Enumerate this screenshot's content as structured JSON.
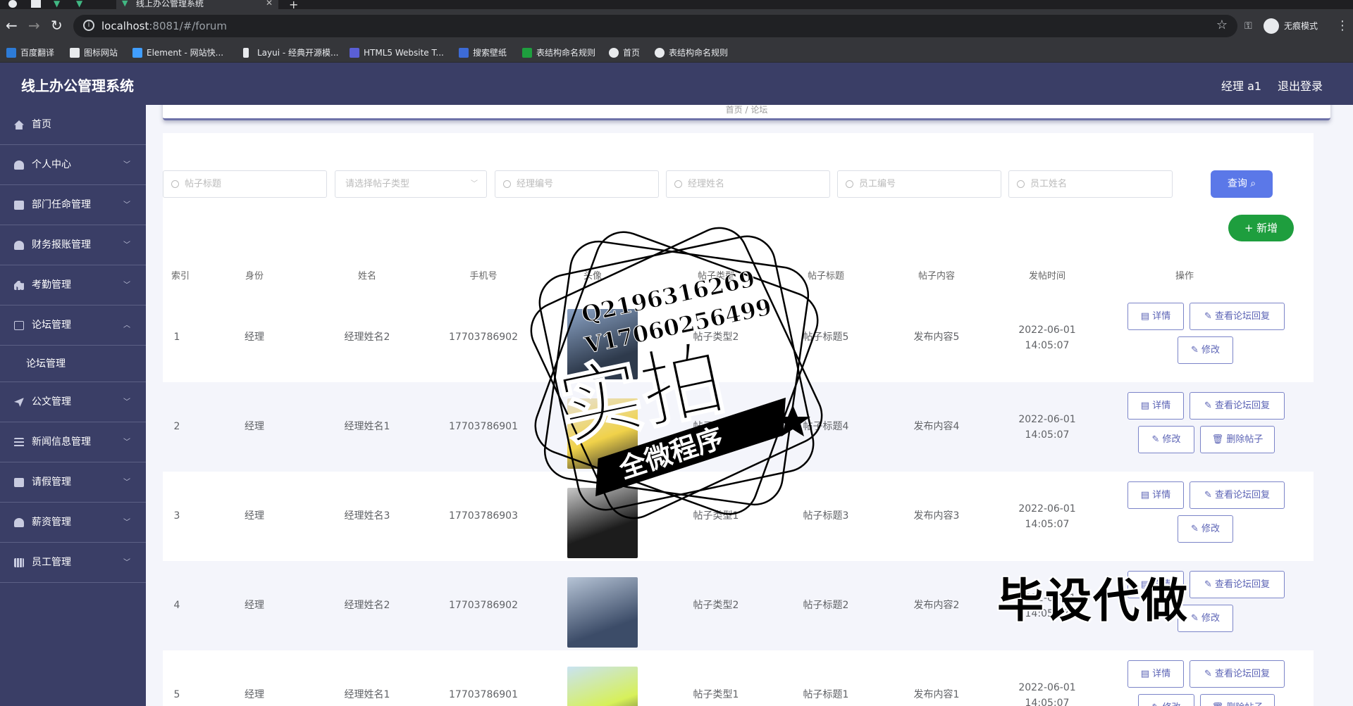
{
  "browser": {
    "tab_title": "线上办公管理系统",
    "url_host": "localhost",
    "url_rest": ":8081/#/forum",
    "incognito_label": "无痕模式",
    "bookmarks": [
      "百度翻译",
      "图标网站",
      "Element - 网站快...",
      "Layui - 经典开源模...",
      "HTML5 Website T...",
      "搜索壁纸",
      "表结构命名规则",
      "首页",
      "表结构命名规则"
    ]
  },
  "header": {
    "title": "线上办公管理系统",
    "user": "经理 a1",
    "logout": "退出登录"
  },
  "sidebar": {
    "items": [
      {
        "label": "首页"
      },
      {
        "label": "个人中心"
      },
      {
        "label": "部门任命管理"
      },
      {
        "label": "财务报账管理"
      },
      {
        "label": "考勤管理"
      },
      {
        "label": "论坛管理"
      },
      {
        "label": "论坛管理"
      },
      {
        "label": "公文管理"
      },
      {
        "label": "新闻信息管理"
      },
      {
        "label": "请假管理"
      },
      {
        "label": "薪资管理"
      },
      {
        "label": "员工管理"
      }
    ]
  },
  "breadcrumb": {
    "home": "首页",
    "current": "论坛"
  },
  "search": {
    "title_ph": "帖子标题",
    "type_ph": "请选择帖子类型",
    "mgr_no_ph": "经理编号",
    "mgr_name_ph": "经理姓名",
    "emp_no_ph": "员工编号",
    "emp_name_ph": "员工姓名",
    "query": "查询",
    "add": "+ 新增"
  },
  "table": {
    "headers": [
      "索引",
      "身份",
      "姓名",
      "手机号",
      "头像",
      "帖子类型",
      "帖子标题",
      "帖子内容",
      "发帖时间",
      "操作"
    ],
    "rows": [
      {
        "idx": "1",
        "role": "经理",
        "name": "经理姓名2",
        "phone": "17703786902",
        "type": "帖子类型2",
        "title": "帖子标题5",
        "content": "发布内容5",
        "time": "2022-06-01 14:05:07",
        "has_delete": false
      },
      {
        "idx": "2",
        "role": "经理",
        "name": "经理姓名1",
        "phone": "17703786901",
        "type": "帖子类型2",
        "title": "帖子标题4",
        "content": "发布内容4",
        "time": "2022-06-01 14:05:07",
        "has_delete": true
      },
      {
        "idx": "3",
        "role": "经理",
        "name": "经理姓名3",
        "phone": "17703786903",
        "type": "帖子类型1",
        "title": "帖子标题3",
        "content": "发布内容3",
        "time": "2022-06-01 14:05:07",
        "has_delete": false
      },
      {
        "idx": "4",
        "role": "经理",
        "name": "经理姓名2",
        "phone": "17703786902",
        "type": "帖子类型2",
        "title": "帖子标题2",
        "content": "发布内容2",
        "time": "2022-06-01 14:05:07",
        "has_delete": false
      },
      {
        "idx": "5",
        "role": "经理",
        "name": "经理姓名1",
        "phone": "17703786901",
        "type": "帖子类型1",
        "title": "帖子标题1",
        "content": "发布内容1",
        "time": "2022-06-01 14:05:07",
        "has_delete": true
      }
    ],
    "ops": {
      "detail": "详情",
      "replies": "查看论坛回复",
      "edit": "修改",
      "delete": "删除帖子"
    }
  },
  "watermark": {
    "line1": "Q2196316269",
    "line2": "V17060256499",
    "big": "实拍",
    "banner": "全微程序",
    "bottom": "毕设代做"
  },
  "colors": {
    "primary": "#3a3e66",
    "query_button": "#5b78e8",
    "add_button": "#1e9e3e"
  }
}
